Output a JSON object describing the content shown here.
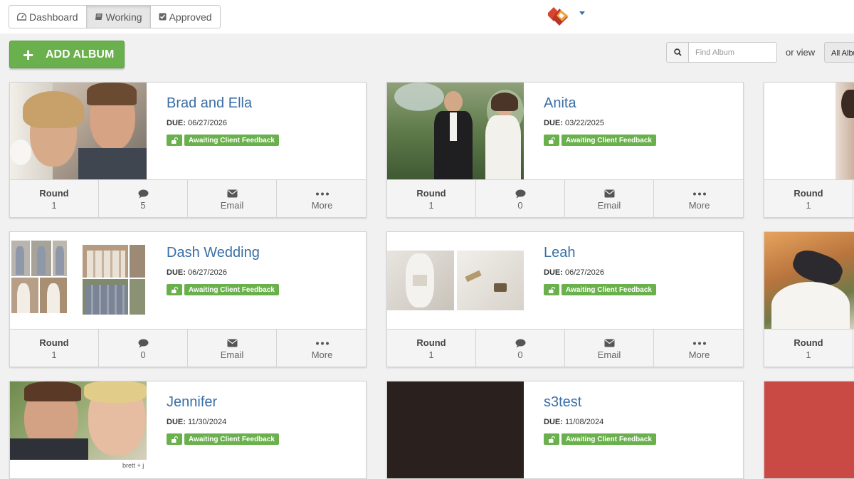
{
  "nav": {
    "tabs": [
      {
        "label": "Dashboard",
        "icon": "dashboard-icon"
      },
      {
        "label": "Working",
        "icon": "book-icon",
        "active": true
      },
      {
        "label": "Approved",
        "icon": "checkbox-icon"
      }
    ]
  },
  "toolbar": {
    "add_album_label": "ADD ALBUM",
    "search_placeholder": "Find Album",
    "or_view_label": "or view",
    "view_selected": "All Albums"
  },
  "colors": {
    "accent_green": "#6ab04c",
    "title_blue": "#3a6ea5",
    "logo_red": "#d9442f",
    "logo_orange": "#f0a23a"
  },
  "card_labels": {
    "round": "Round",
    "email": "Email",
    "more": "More",
    "due": "DUE:",
    "status": "Awaiting Client Feedback"
  },
  "albums": [
    {
      "title": "Brad and Ella",
      "due": "06/27/2026",
      "round": "1",
      "comments": "5"
    },
    {
      "title": "Anita",
      "due": "03/22/2025",
      "round": "1",
      "comments": "0"
    },
    {
      "title": "",
      "due": "",
      "round": "1",
      "comments": ""
    },
    {
      "title": "Dash Wedding",
      "due": "06/27/2026",
      "round": "1",
      "comments": "0"
    },
    {
      "title": "Leah",
      "due": "06/27/2026",
      "round": "1",
      "comments": "0"
    },
    {
      "title": "",
      "due": "",
      "round": "1",
      "comments": ""
    },
    {
      "title": "Jennifer",
      "due": "11/30/2024",
      "round": "",
      "comments": "",
      "thumb_caption": "brett + j"
    },
    {
      "title": "s3test",
      "due": "11/08/2024",
      "round": "",
      "comments": ""
    }
  ]
}
